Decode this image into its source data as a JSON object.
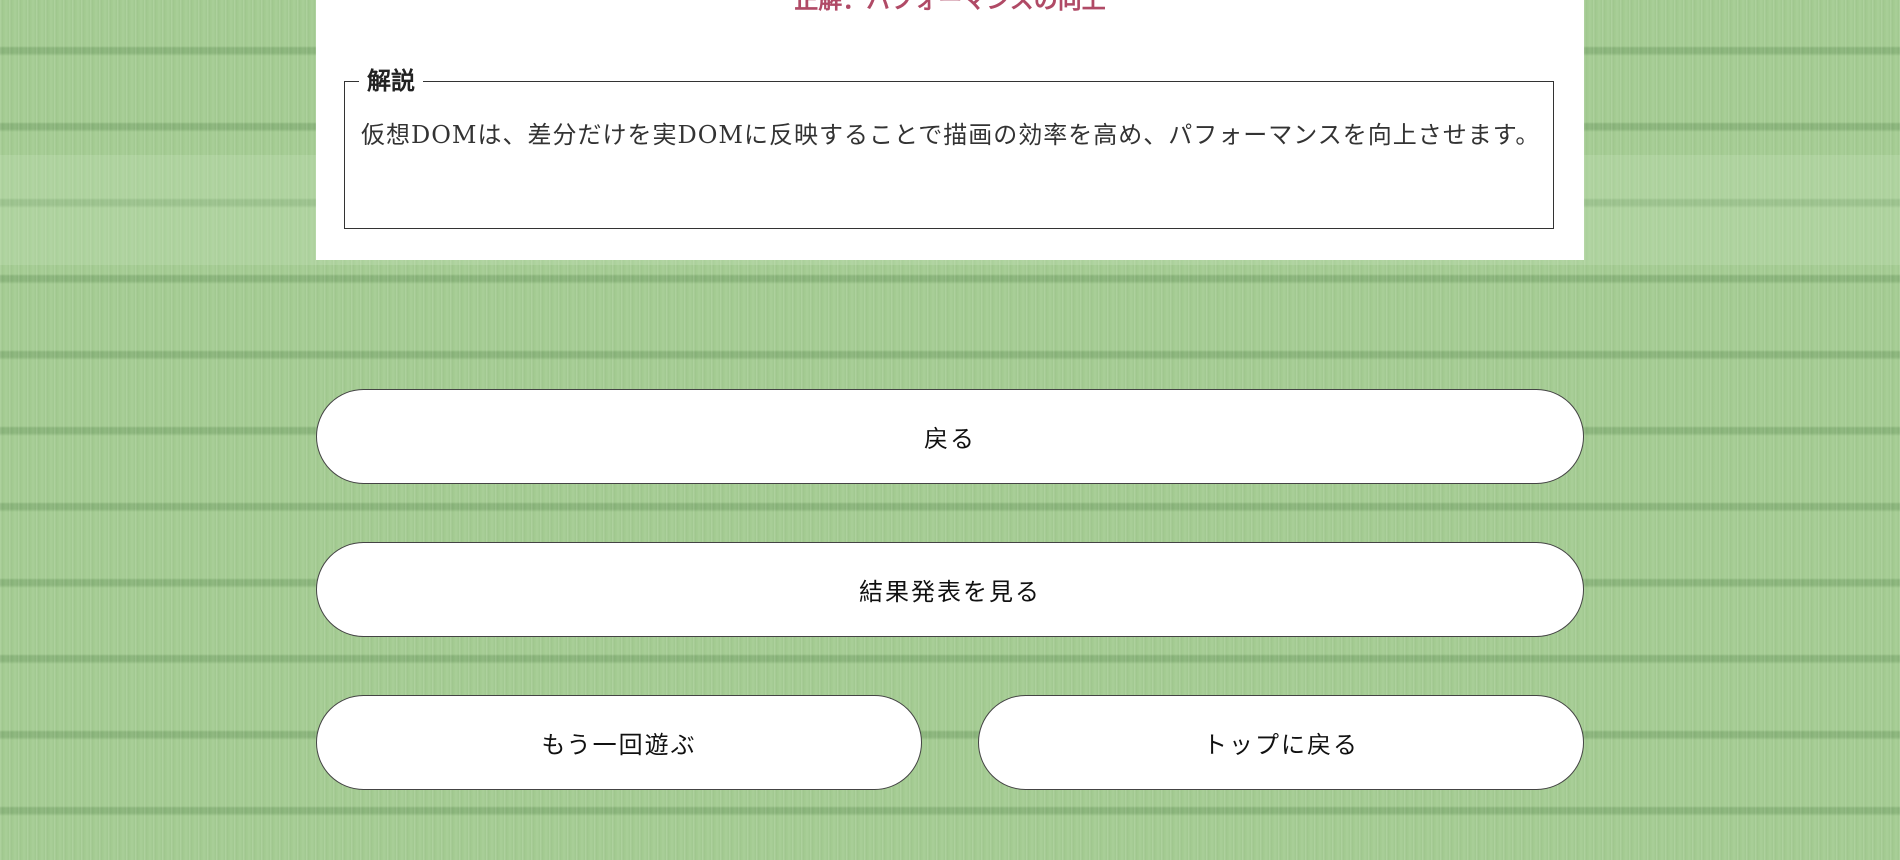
{
  "result": {
    "answer_title": "正解：パフォーマンスの向上"
  },
  "explanation": {
    "heading": "解説",
    "text": "仮想DOMは、差分だけを実DOMに反映することで描画の効率を高め、パフォーマンスを向上させます。"
  },
  "buttons": {
    "back": "戻る",
    "view_results": "結果発表を見る",
    "play_again": "もう一回遊ぶ",
    "back_to_top": "トップに戻る"
  }
}
